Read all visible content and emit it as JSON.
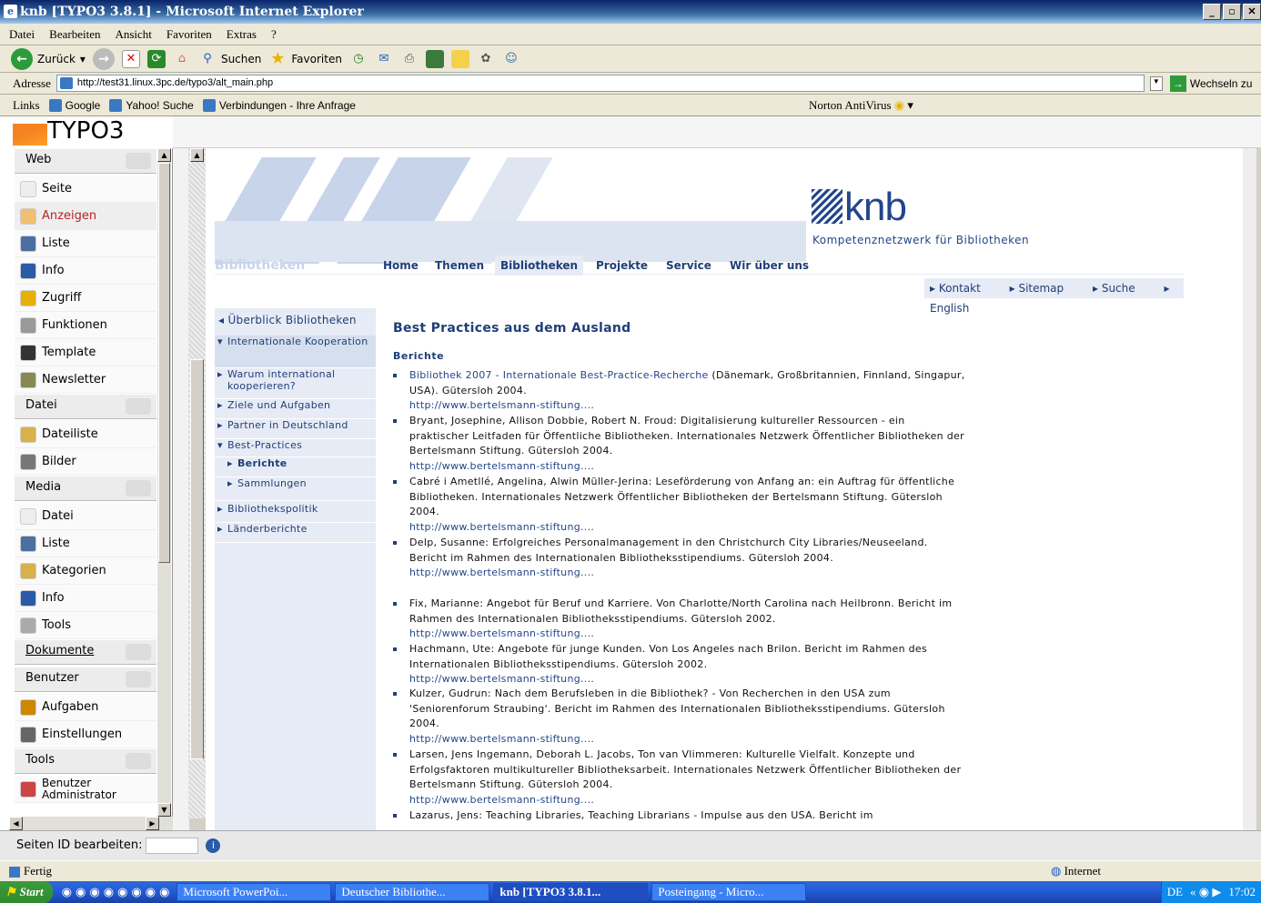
{
  "window": {
    "title": "knb [TYPO3 3.8.1] - Microsoft Internet Explorer"
  },
  "menubar": [
    "Datei",
    "Bearbeiten",
    "Ansicht",
    "Favoriten",
    "Extras",
    "?"
  ],
  "toolbar": {
    "back": "Zurück",
    "search": "Suchen",
    "favorites": "Favoriten"
  },
  "address": {
    "label": "Adresse",
    "url": "http://test31.linux.3pc.de/typo3/alt_main.php",
    "go": "Wechseln zu"
  },
  "links": {
    "label": "Links",
    "items": [
      "Google",
      "Yahoo! Suche",
      "Verbindungen - Ihre Anfrage"
    ],
    "norton": "Norton AntiVirus"
  },
  "typo3": {
    "logo": "TYPO3",
    "modules": [
      {
        "type": "group",
        "label": "Web"
      },
      {
        "type": "item",
        "label": "Seite",
        "icon": "page-icon"
      },
      {
        "type": "item",
        "label": "Anzeigen",
        "icon": "magnifier-icon",
        "active": true
      },
      {
        "type": "item",
        "label": "Liste",
        "icon": "list-icon"
      },
      {
        "type": "item",
        "label": "Info",
        "icon": "info-icon"
      },
      {
        "type": "item",
        "label": "Zugriff",
        "icon": "lock-icon"
      },
      {
        "type": "item",
        "label": "Funktionen",
        "icon": "gear-icon"
      },
      {
        "type": "item",
        "label": "Template",
        "icon": "template-icon"
      },
      {
        "type": "item",
        "label": "Newsletter",
        "icon": "newsletter-icon"
      },
      {
        "type": "group",
        "label": "Datei"
      },
      {
        "type": "item",
        "label": "Dateiliste",
        "icon": "folder-icon"
      },
      {
        "type": "item",
        "label": "Bilder",
        "icon": "camera-icon"
      },
      {
        "type": "group",
        "label": "Media"
      },
      {
        "type": "item",
        "label": "Datei",
        "icon": "file-icon"
      },
      {
        "type": "item",
        "label": "Liste",
        "icon": "list-icon"
      },
      {
        "type": "item",
        "label": "Kategorien",
        "icon": "folder-icon"
      },
      {
        "type": "item",
        "label": "Info",
        "icon": "info-icon"
      },
      {
        "type": "item",
        "label": "Tools",
        "icon": "tools-icon"
      },
      {
        "type": "group",
        "label": "Dokumente"
      },
      {
        "type": "group",
        "label": "Benutzer"
      },
      {
        "type": "item",
        "label": "Aufgaben",
        "icon": "pencil-icon"
      },
      {
        "type": "item",
        "label": "Einstellungen",
        "icon": "wrench-icon"
      },
      {
        "type": "group",
        "label": "Tools"
      },
      {
        "type": "item",
        "label": "Benutzer Administrator",
        "icon": "user-icon"
      }
    ],
    "footer_label": "Seiten ID bearbeiten:"
  },
  "site": {
    "logo": "knb",
    "logo_sub": "Kompetenznetzwerk für Bibliotheken",
    "section": "Bibliotheken",
    "nav": [
      "Home",
      "Themen",
      "Bibliotheken",
      "Projekte",
      "Service",
      "Wir über uns"
    ],
    "utils": [
      "Kontakt",
      "Sitemap",
      "Suche",
      "English"
    ],
    "leftnav": [
      "Überblick Bibliotheken",
      "Internationale Kooperation",
      "Warum international kooperieren?",
      "Ziele und Aufgaben",
      "Partner in Deutschland",
      "Best-Practices",
      "Berichte",
      "Sammlungen",
      "Bibliothekspolitik",
      "Länderberichte"
    ],
    "heading": "Best Practices aus dem Ausland",
    "subheading": "Berichte",
    "entries": [
      {
        "link_title": "Bibliothek 2007 - Internationale Best-Practice-Recherche",
        "text": " (Dänemark, Großbritannien, Finnland, Singapur, USA). Gütersloh 2004.",
        "url": "http://www.bertelsmann-stiftung...."
      },
      {
        "link_title": "",
        "text": "Bryant, Josephine, Allison Dobbie, Robert N. Froud: Digitalisierung kultureller Ressourcen - ein praktischer Leitfaden für Öffentliche Bibliotheken. Internationales Netzwerk Öffentlicher Bibliotheken der Bertelsmann Stiftung. Gütersloh 2004.",
        "url": "http://www.bertelsmann-stiftung...."
      },
      {
        "link_title": "",
        "text": "Cabré i Ametllé, Angelina, Alwin Müller-Jerina: Leseförderung von Anfang an: ein Auftrag für öffentliche Bibliotheken. Internationales Netzwerk Öffentlicher Bibliotheken der Bertelsmann Stiftung. Gütersloh 2004.",
        "url": "http://www.bertelsmann-stiftung...."
      },
      {
        "link_title": "",
        "text": "Delp, Susanne: Erfolgreiches Personalmanagement in den Christchurch City Libraries/Neuseeland. Bericht im Rahmen des Internationalen Bibliotheksstipendiums. Gütersloh 2004.",
        "url": "http://www.bertelsmann-stiftung...."
      },
      {
        "link_title": "",
        "text": "Fix, Marianne: Angebot für Beruf und Karriere. Von Charlotte/North Carolina nach Heilbronn. Bericht im Rahmen des Internationalen Bibliotheksstipendiums. Gütersloh 2002.",
        "url": "http://www.bertelsmann-stiftung...."
      },
      {
        "link_title": "",
        "text": "Hachmann, Ute: Angebote für junge Kunden. Von Los Angeles nach Brilon. Bericht im Rahmen des Internationalen Bibliotheksstipendiums. Gütersloh 2002.",
        "url": "http://www.bertelsmann-stiftung...."
      },
      {
        "link_title": "",
        "text": "Kulzer, Gudrun: Nach dem Berufsleben in die Bibliothek? - Von Recherchen in den USA zum 'Seniorenforum Straubing'. Bericht im Rahmen des Internationalen Bibliotheksstipendiums. Gütersloh 2004.",
        "url": "http://www.bertelsmann-stiftung...."
      },
      {
        "link_title": "",
        "text": "Larsen, Jens Ingemann, Deborah L. Jacobs, Ton van Vlimmeren: Kulturelle Vielfalt. Konzepte und Erfolgsfaktoren multikultureller Bibliotheksarbeit. Internationales Netzwerk Öffentlicher Bibliotheken der Bertelsmann Stiftung. Gütersloh 2004.",
        "url": "http://www.bertelsmann-stiftung...."
      },
      {
        "link_title": "",
        "text": "Lazarus, Jens: Teaching Libraries, Teaching Librarians - Impulse aus den USA. Bericht im",
        "url": ""
      }
    ]
  },
  "status": {
    "text": "Fertig",
    "zone": "Internet"
  },
  "taskbar": {
    "start": "Start",
    "tasks": [
      "Microsoft PowerPoi...",
      "Deutscher Bibliothe...",
      "knb [TYPO3 3.8.1...",
      "Posteingang - Micro..."
    ],
    "lang": "DE",
    "time": "17:02"
  }
}
